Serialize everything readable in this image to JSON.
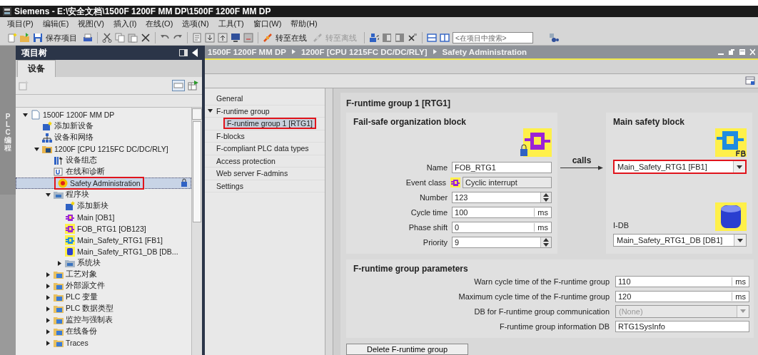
{
  "window": {
    "title": "Siemens  -  E:\\安全文档\\1500F 1200F MM DP\\1500F 1200F MM DP"
  },
  "menu": [
    "项目(P)",
    "编辑(E)",
    "视图(V)",
    "插入(I)",
    "在线(O)",
    "选项(N)",
    "工具(T)",
    "窗口(W)",
    "帮助(H)"
  ],
  "toolbar": {
    "save_label": "保存项目",
    "go_online": {
      "label": "转至在线",
      "disabled": false
    },
    "go_offline": {
      "label": "转至离线",
      "disabled": true
    },
    "search": {
      "placeholder": "<在项目中搜索>"
    }
  },
  "side_tab": "PLC编程",
  "project_tree": {
    "title": "项目树",
    "tab": "设备",
    "items": [
      {
        "label": "1500F 1200F MM DP",
        "kind": "project",
        "selected": false,
        "expanded": true,
        "children": [
          {
            "label": "添加新设备",
            "kind": "add",
            "selected": false
          },
          {
            "label": "设备和网络",
            "kind": "network",
            "selected": false
          },
          {
            "label": "1200F [CPU 1215FC DC/DC/RLY]",
            "kind": "cpu",
            "selected": false,
            "expanded": true,
            "children": [
              {
                "label": "设备组态",
                "kind": "config",
                "selected": false
              },
              {
                "label": "在线和诊断",
                "kind": "diag",
                "selected": false
              },
              {
                "label": "Safety Administration",
                "kind": "safety",
                "selected": true
              },
              {
                "label": "程序块",
                "kind": "blocks",
                "selected": false,
                "expanded": true,
                "children": [
                  {
                    "label": "添加新块",
                    "kind": "add",
                    "selected": false
                  },
                  {
                    "label": "Main [OB1]",
                    "kind": "ob",
                    "selected": false
                  },
                  {
                    "label": "FOB_RTG1 [OB123]",
                    "kind": "fob",
                    "selected": false
                  },
                  {
                    "label": "Main_Safety_RTG1 [FB1]",
                    "kind": "fb",
                    "selected": false
                  },
                  {
                    "label": "Main_Safety_RTG1_DB [DB...",
                    "kind": "db",
                    "selected": false
                  },
                  {
                    "label": "系统块",
                    "kind": "blocks",
                    "selected": false,
                    "expanded": false
                  }
                ]
              },
              {
                "label": "工艺对象",
                "kind": "folder",
                "selected": false,
                "expanded": false
              },
              {
                "label": "外部源文件",
                "kind": "folder",
                "selected": false,
                "expanded": false
              },
              {
                "label": "PLC 变量",
                "kind": "folder",
                "selected": false,
                "expanded": false
              },
              {
                "label": "PLC 数据类型",
                "kind": "folder",
                "selected": false,
                "expanded": false
              },
              {
                "label": "监控与强制表",
                "kind": "folder",
                "selected": false,
                "expanded": false
              },
              {
                "label": "在线备份",
                "kind": "folder",
                "selected": false,
                "expanded": false
              },
              {
                "label": "Traces",
                "kind": "folder",
                "selected": false,
                "expanded": false
              }
            ]
          }
        ]
      }
    ]
  },
  "editor": {
    "breadcrumb": [
      "1500F 1200F MM DP",
      "1200F [CPU 1215FC DC/DC/RLY]",
      "Safety Administration"
    ],
    "nav": [
      {
        "label": "General",
        "selected": false
      },
      {
        "label": "F-runtime group",
        "selected": false,
        "expanded": true,
        "children": [
          {
            "label": "F-runtime group 1 [RTG1]",
            "selected": true
          }
        ]
      },
      {
        "label": "F-blocks",
        "selected": false
      },
      {
        "label": "F-compliant PLC data types",
        "selected": false
      },
      {
        "label": "Access protection",
        "selected": false
      },
      {
        "label": "Web server F-admins",
        "selected": false
      },
      {
        "label": "Settings",
        "selected": false
      }
    ],
    "group_title": "F-runtime group 1 [RTG1]",
    "fob": {
      "title": "Fail-safe organization block",
      "fields": [
        {
          "label": "Name",
          "value": "FOB_RTG1",
          "kind": "text"
        },
        {
          "label": "Event class",
          "value": "Cyclic interrupt",
          "kind": "event"
        },
        {
          "label": "Number",
          "value": "123",
          "kind": "spinner"
        },
        {
          "label": "Cycle time",
          "value": "100",
          "unit": "ms",
          "kind": "unit"
        },
        {
          "label": "Phase shift",
          "value": "0",
          "unit": "ms",
          "kind": "unit"
        },
        {
          "label": "Priority",
          "value": "9",
          "kind": "spinner"
        }
      ]
    },
    "calls": "calls",
    "main_block": {
      "title": "Main safety block",
      "value": "Main_Safety_RTG1 [FB1]",
      "highlighted": true,
      "idb_label": "I-DB",
      "idb_value": "Main_Safety_RTG1_DB [DB1]"
    },
    "params": {
      "title": "F-runtime group parameters",
      "rows": [
        {
          "label": "Warn cycle time of the F-runtime group",
          "value": "110",
          "unit": "ms",
          "kind": "unit",
          "disabled": false
        },
        {
          "label": "Maximum cycle time of the F-runtime group",
          "value": "120",
          "unit": "ms",
          "kind": "unit",
          "disabled": false
        },
        {
          "label": "DB for F-runtime group communication",
          "value": "(None)",
          "kind": "dropdown",
          "disabled": true
        },
        {
          "label": "F-runtime group information DB",
          "value": "RTG1SysInfo",
          "kind": "text",
          "disabled": false
        }
      ]
    },
    "delete_button": "Delete F-runtime group"
  }
}
